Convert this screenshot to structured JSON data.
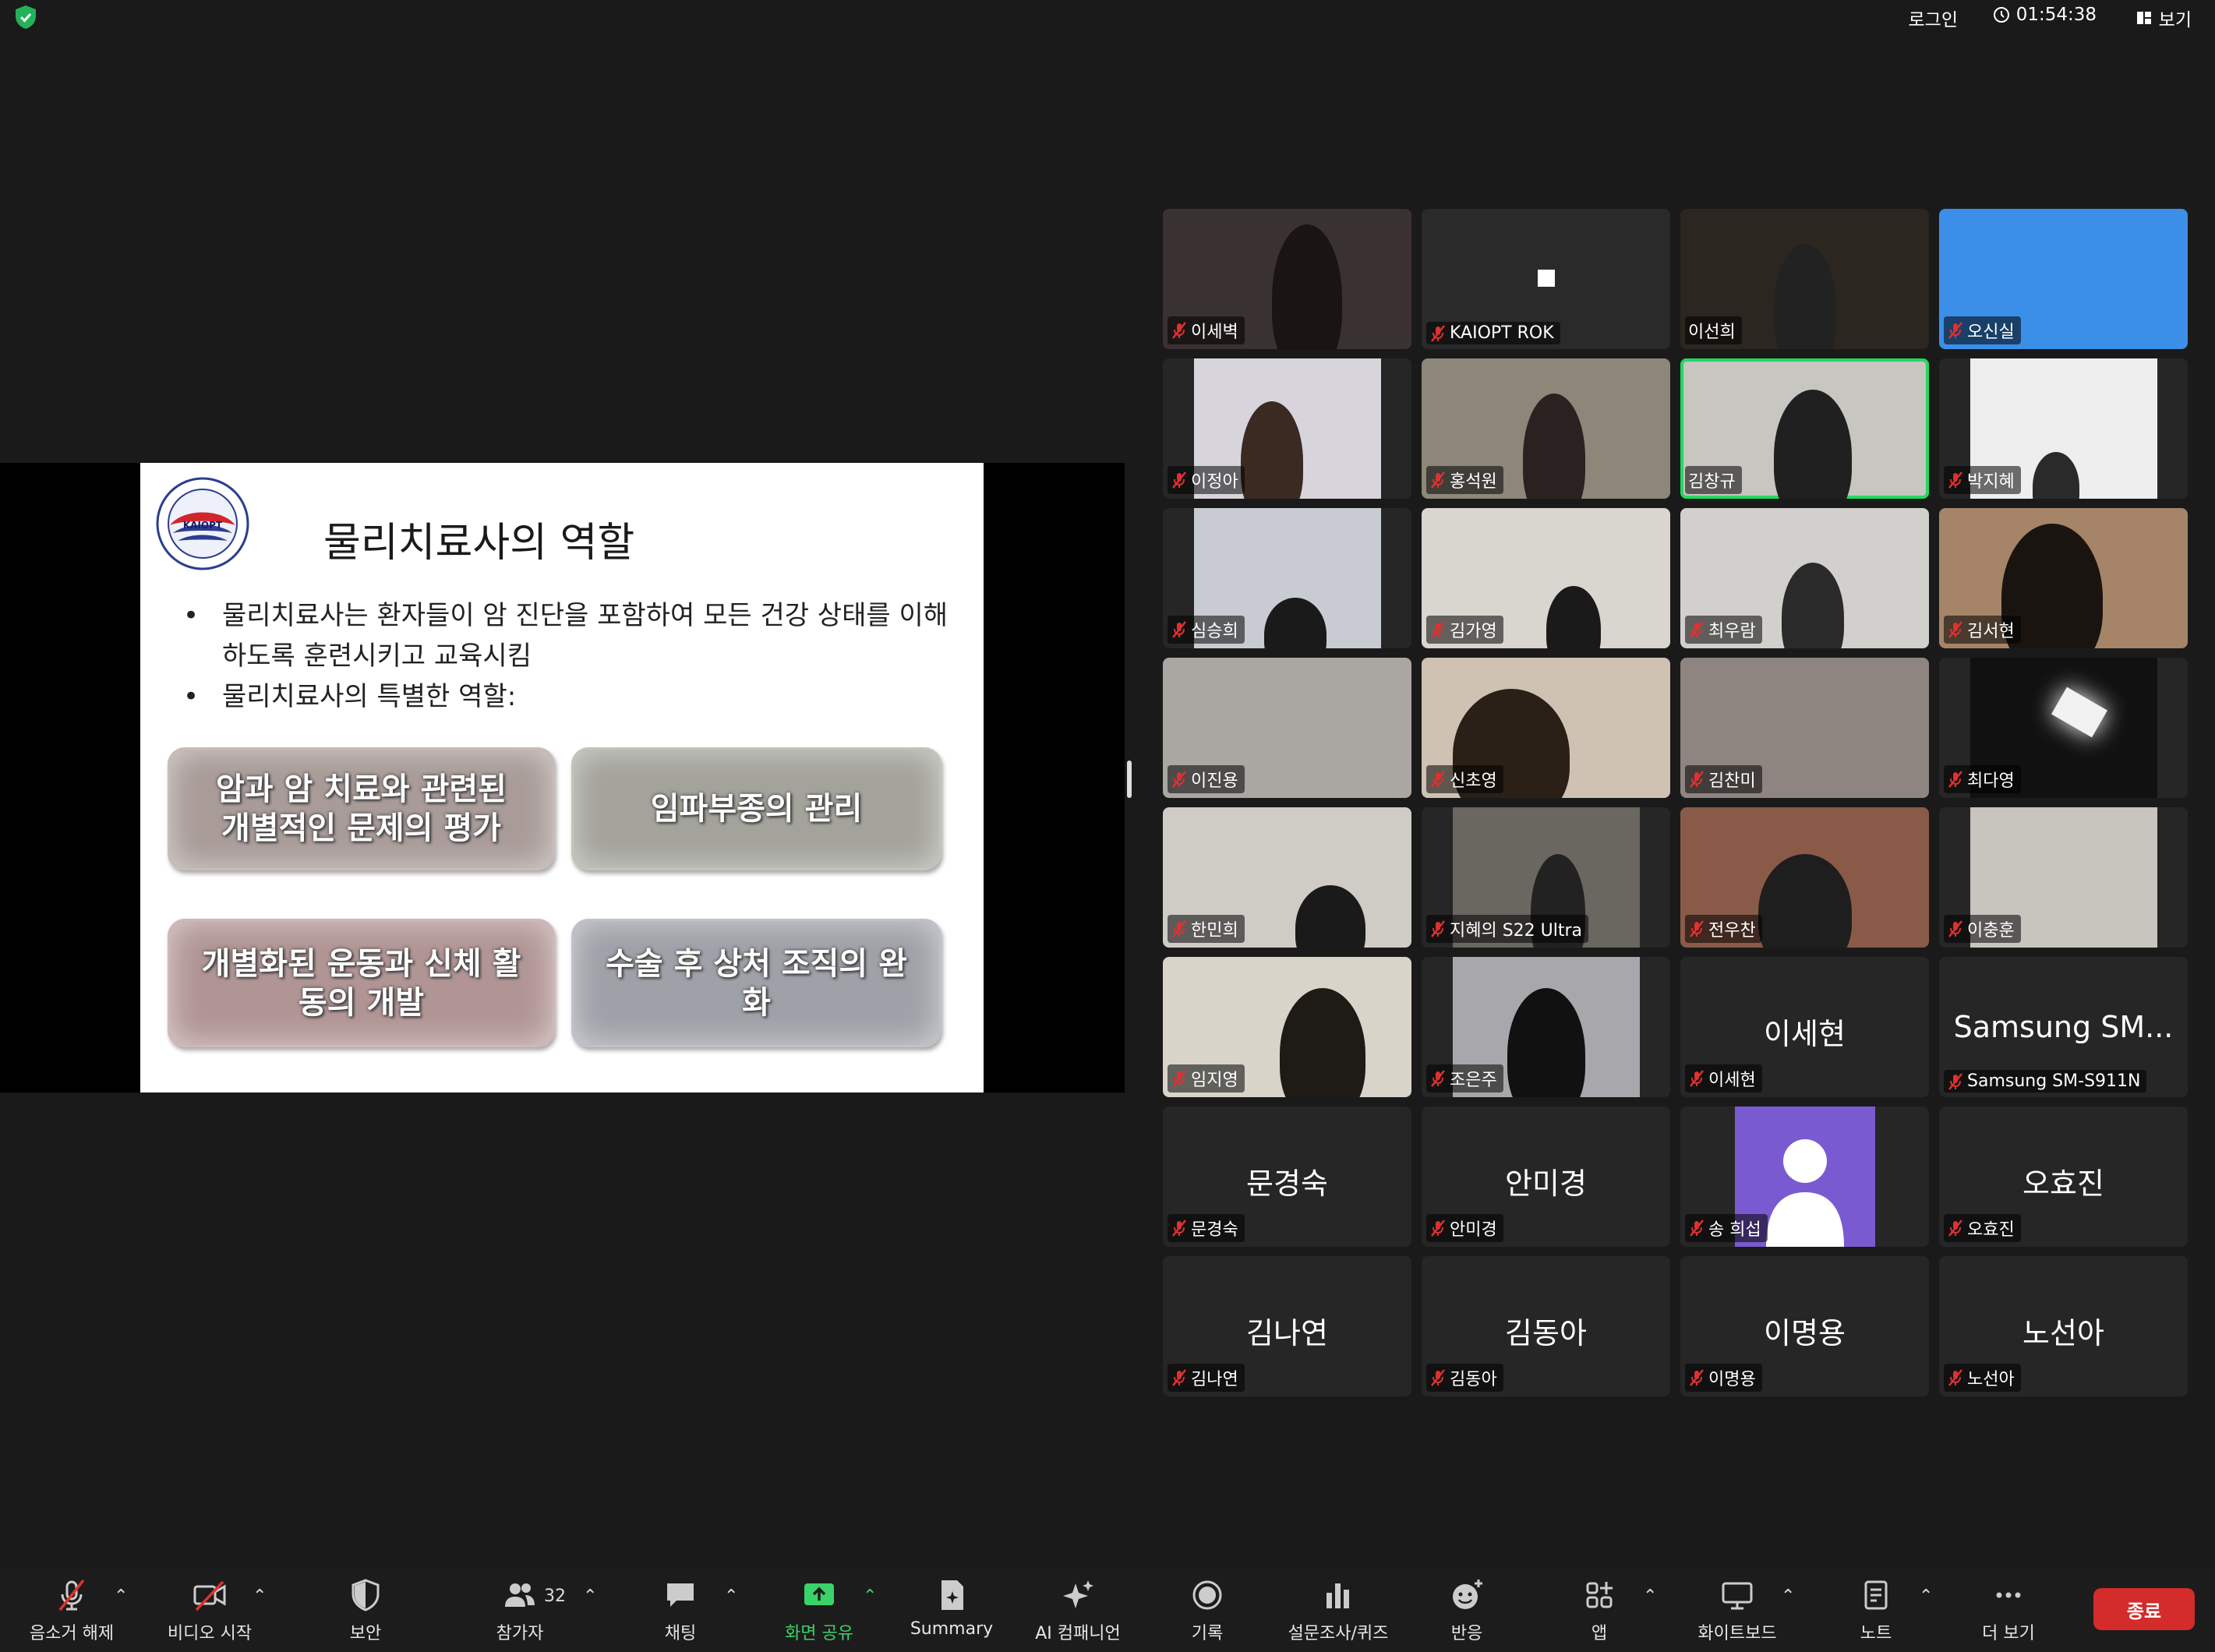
{
  "topbar": {
    "login": "로그인",
    "timer": "01:54:38",
    "view": "보기"
  },
  "slide": {
    "logo_text": "KAIOPT",
    "title": "물리치료사의 역할",
    "bullets": [
      "물리치료사는 환자들이 암 진단을 포함하여 모든 건강 상태를 이해하도록 훈련시키고 교육시킴",
      "물리치료사의 특별한 역할:"
    ],
    "boxes": [
      "암과 암 치료와 관련된 개별적인 문제의 평가",
      "임파부종의 관리",
      "개별화된 운동과 신체 활동의 개발",
      "수술 후 상처 조직의 완화"
    ]
  },
  "participants": [
    {
      "name": "이세벽",
      "muted": true
    },
    {
      "name": "KAIOPT ROK",
      "muted": true
    },
    {
      "name": "이선희",
      "muted": false
    },
    {
      "name": "오신실",
      "muted": true
    },
    {
      "name": "이정아",
      "muted": true
    },
    {
      "name": "홍석원",
      "muted": true
    },
    {
      "name": "김창규",
      "muted": false,
      "active": true
    },
    {
      "name": "박지혜",
      "muted": true
    },
    {
      "name": "심승희",
      "muted": true
    },
    {
      "name": "김가영",
      "muted": true
    },
    {
      "name": "최우람",
      "muted": true
    },
    {
      "name": "김서현",
      "muted": true
    },
    {
      "name": "이진용",
      "muted": true
    },
    {
      "name": "신초영",
      "muted": true
    },
    {
      "name": "김찬미",
      "muted": true
    },
    {
      "name": "최다영",
      "muted": true
    },
    {
      "name": "한민희",
      "muted": true
    },
    {
      "name": "지혜의 S22 Ultra",
      "muted": true
    },
    {
      "name": "전우찬",
      "muted": true
    },
    {
      "name": "이충훈",
      "muted": true
    },
    {
      "name": "임지영",
      "muted": true
    },
    {
      "name": "조은주",
      "muted": true
    },
    {
      "name": "이세현",
      "display": "이세현",
      "muted": true
    },
    {
      "name": "Samsung SM-S911N",
      "display": "Samsung SM...",
      "muted": true
    },
    {
      "name": "문경숙",
      "display": "문경숙",
      "muted": true
    },
    {
      "name": "안미경",
      "display": "안미경",
      "muted": true
    },
    {
      "name": "송 희섭",
      "muted": true
    },
    {
      "name": "오효진",
      "display": "오효진",
      "muted": true
    },
    {
      "name": "김나연",
      "display": "김나연",
      "muted": true
    },
    {
      "name": "김동아",
      "display": "김동아",
      "muted": true
    },
    {
      "name": "이명용",
      "display": "이명용",
      "muted": true
    },
    {
      "name": "노선아",
      "display": "노선아",
      "muted": true
    }
  ],
  "toolbar": {
    "unmute": "음소거 해제",
    "start_video": "비디오 시작",
    "security": "보안",
    "participants": "참가자",
    "participant_count": "32",
    "chat": "채팅",
    "share": "화면 공유",
    "summary": "Summary",
    "ai_companion": "AI 컴패니언",
    "record": "기록",
    "polls": "설문조사/퀴즈",
    "reactions": "반응",
    "apps": "앱",
    "whiteboard": "화이트보드",
    "notes": "노트",
    "more": "더 보기",
    "end": "종료"
  },
  "colors": {
    "accent_green": "#23d860",
    "end_red": "#d42b2b",
    "share_green": "#39d36a"
  }
}
